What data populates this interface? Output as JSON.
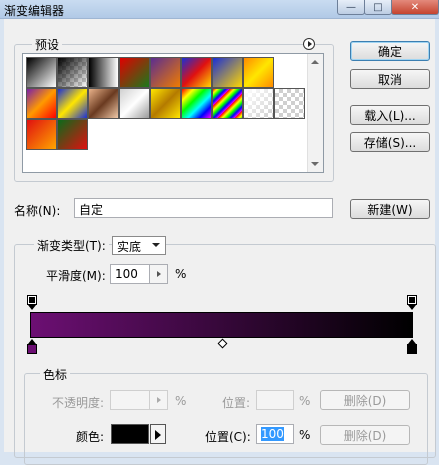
{
  "window": {
    "title": "渐变编辑器",
    "minimize_glyph": "—",
    "maximize_glyph": "□",
    "close_glyph": "✕"
  },
  "presets": {
    "legend": "预设",
    "menu_icon": "play-circle-icon",
    "swatches": [
      [
        "linear-gradient(135deg,#000,#fff)",
        "checker-black",
        "linear-gradient(90deg,#000,#fff)",
        "linear-gradient(135deg,#e00000,#1a7a1a)",
        "linear-gradient(135deg,#5a2d91,#f07b00)",
        "linear-gradient(135deg,#1a2fd6,#e01010,#ffd700)",
        "linear-gradient(135deg,#1a2fd6,#ffd700)",
        "linear-gradient(135deg,#ff8a00,#ffe600,#ff8a00)"
      ],
      [
        "linear-gradient(135deg,#7a1fa8,#ff9a00,#ff0000)",
        "linear-gradient(135deg,#1a2fd6,#ffe600,#1a2fd6)",
        "linear-gradient(135deg,#e9b28a,#6a3a20,#f0c9a8)",
        "linear-gradient(135deg,#d0d0d0,#ffffff,#9a9a9a)",
        "linear-gradient(135deg,#ffe600,#b47a00,#ffe600)",
        "linear-gradient(135deg,#ff0000,#ffff00,#00ff00,#00ffff,#0000ff,#ff00ff)",
        "repeating-linear-gradient(135deg,#ff0000 0,#ffff00 3px,#00ff00 6px,#0000ff 9px,#ff00ff 12px)",
        "checker-white",
        "checker"
      ],
      [
        "linear-gradient(135deg,#e01010,#ffa500)",
        "linear-gradient(135deg,#0a6a1a,#e01010)"
      ]
    ],
    "scroll_up_icon": "scroll-up-icon",
    "scroll_down_icon": "scroll-down-icon"
  },
  "buttons": {
    "ok": "确定",
    "cancel": "取消",
    "load": "载入(L)...",
    "save": "存储(S)...",
    "new": "新建(W)"
  },
  "name": {
    "label": "名称(N):",
    "value": "自定"
  },
  "gradient": {
    "type_label": "渐变类型(T):",
    "type_value": "实底",
    "smoothness_label": "平滑度(M):",
    "smoothness_value": "100",
    "smoothness_unit": "%",
    "bar_colors": [
      "#6c0f73",
      "#000000"
    ]
  },
  "stops": {
    "legend": "色标",
    "opacity_label": "不透明度:",
    "opacity_unit": "%",
    "opacity_location_label": "位置:",
    "opacity_location_unit": "%",
    "opacity_delete": "删除(D)",
    "color_label": "颜色:",
    "color_value": "#000000",
    "location_label": "位置(C):",
    "location_value": "100",
    "location_unit": "%",
    "color_delete": "删除(D)"
  },
  "colors": {
    "accent": "#3c7fb1",
    "selection": "#3399ff"
  }
}
